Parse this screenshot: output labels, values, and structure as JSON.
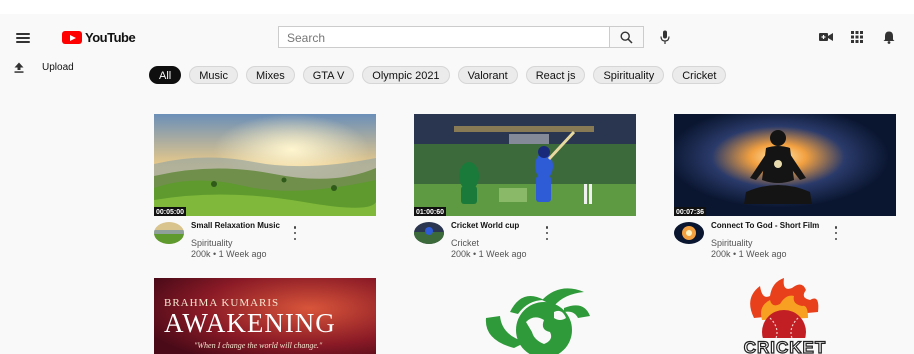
{
  "header": {
    "logo_text": "YouTube",
    "search_placeholder": "Search"
  },
  "sidebar": {
    "upload_label": "Upload"
  },
  "chips": [
    "All",
    "Music",
    "Mixes",
    "GTA V",
    "Olympic 2021",
    "Valorant",
    "React js",
    "Spirituality",
    "Cricket"
  ],
  "videos": [
    {
      "title": "Small Relaxation Music",
      "channel": "Spirituality",
      "stats": "200k • 1 Week ago",
      "duration": "00:05:00"
    },
    {
      "title": "Cricket World cup",
      "channel": "Cricket",
      "stats": "200k • 1 Week ago",
      "duration": "01:00:60"
    },
    {
      "title": "Connect To God - Short Film",
      "channel": "Spirituality",
      "stats": "200k • 1 Week ago",
      "duration": "00:07:36"
    }
  ],
  "row2": {
    "card1_line1": "BRAHMA KUMARIS",
    "card1_line2": "AWAKENING",
    "card1_line3": "\"When I change the world will change.\"",
    "card3_text": "CRICKET"
  },
  "colors": {
    "brand_red": "#ff0000",
    "active_chip": "#0f0f0f",
    "chip_bg": "#ebebeb",
    "page_bg": "#f9f9f9"
  },
  "icons": [
    "menu-icon",
    "youtube-logo-icon",
    "search-icon",
    "mic-icon",
    "video-camera-icon",
    "apps-grid-icon",
    "bell-icon",
    "upload-icon",
    "more-vert-icon"
  ]
}
